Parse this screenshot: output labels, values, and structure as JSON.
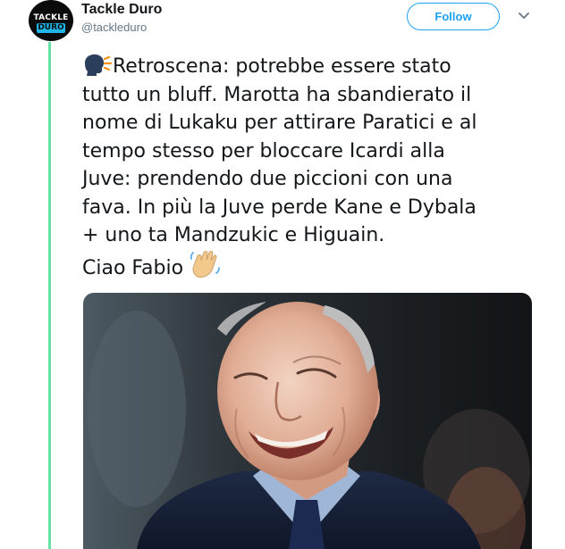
{
  "tweet": {
    "display_name": "Tackle Duro",
    "handle": "@tackleduro",
    "follow_label": "Follow",
    "avatar_logo": {
      "top": "TACKLE",
      "bottom": "DURO"
    },
    "accent_color": "#1da1f2",
    "thread_line_color": "#66e3a4",
    "text_lines": [
      "Retroscena: potrebbe essere stato",
      "tutto un bluff. Marotta ha sbandierato il",
      "nome di Lukaku per attirare Paratici e al",
      "tempo stesso per bloccare Icardi alla",
      "Juve: prendendo due piccioni con una",
      "fava. In più la Juve perde Kane e Dybala",
      "+ uno ta Mandzukic e Higuain.",
      "Ciao Fabio"
    ],
    "leading_icon": "speaking-head-icon",
    "trailing_icon": "waving-hand-icon",
    "media": {
      "type": "photo",
      "subject": "smiling-man-photo"
    }
  }
}
